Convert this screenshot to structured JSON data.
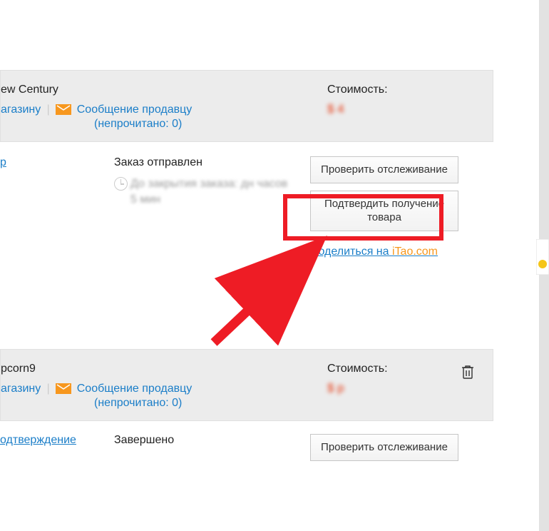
{
  "order1": {
    "store_name": "ew Century",
    "store_link_partial": "агазину",
    "message_seller": "Сообщение продавцу",
    "unread": "(непрочитано: 0)",
    "cost_label": "Стоимость:",
    "cost_value": "$ 4",
    "detail_link": "р",
    "status_title": "Заказ отправлен",
    "timer_text": "До закрытия заказа: дн часов 5 мин",
    "btn_track": "Проверить отслеживание",
    "btn_confirm": "Подтвердить получение товара",
    "share_prefix": "Поделиться на ",
    "share_site": "iTao.com"
  },
  "order2": {
    "store_name": "pcorn9",
    "store_link_partial": "агазину",
    "message_seller": "Сообщение продавцу",
    "unread": "(непрочитано: 0)",
    "cost_label": "Стоимость:",
    "cost_value": "$ р",
    "detail_link": "одтверждение",
    "status_title": "Завершено",
    "btn_track": "Проверить отслеживание"
  }
}
